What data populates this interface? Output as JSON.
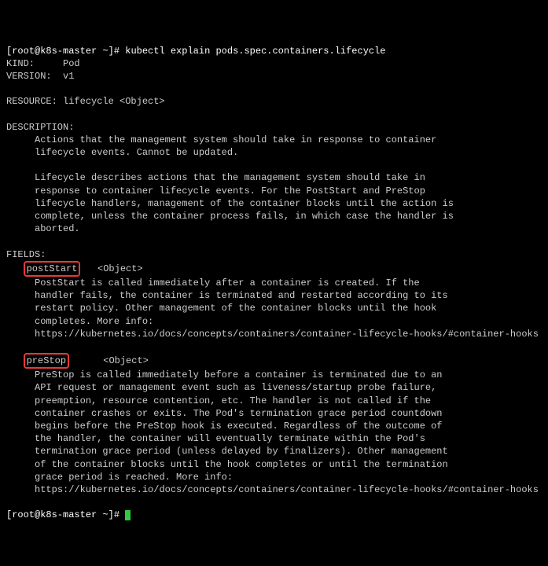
{
  "prompt1": {
    "open": "[",
    "userhost": "root@k8s-master",
    "sep": " ",
    "path": "~",
    "close": "]#",
    "command": " kubectl explain pods.spec.containers.lifecycle"
  },
  "kind_line": "KIND:     Pod",
  "version_line": "VERSION:  v1",
  "resource_line": "RESOURCE: lifecycle <Object>",
  "description_header": "DESCRIPTION:",
  "description_p1": "     Actions that the management system should take in response to container\n     lifecycle events. Cannot be updated.",
  "description_p2": "     Lifecycle describes actions that the management system should take in\n     response to container lifecycle events. For the PostStart and PreStop\n     lifecycle handlers, management of the container blocks until the action is\n     complete, unless the container process fails, in which case the handler is\n     aborted.",
  "fields_header": "FIELDS:",
  "postStart": {
    "name": "postStart",
    "type": "   <Object>",
    "desc": "     PostStart is called immediately after a container is created. If the\n     handler fails, the container is terminated and restarted according to its\n     restart policy. Other management of the container blocks until the hook\n     completes. More info:\n     https://kubernetes.io/docs/concepts/containers/container-lifecycle-hooks/#container-hooks"
  },
  "preStop": {
    "name": "preStop",
    "type": "      <Object>",
    "desc": "     PreStop is called immediately before a container is terminated due to an\n     API request or management event such as liveness/startup probe failure,\n     preemption, resource contention, etc. The handler is not called if the\n     container crashes or exits. The Pod's termination grace period countdown\n     begins before the PreStop hook is executed. Regardless of the outcome of\n     the handler, the container will eventually terminate within the Pod's\n     termination grace period (unless delayed by finalizers). Other management\n     of the container blocks until the hook completes or until the termination\n     grace period is reached. More info:\n     https://kubernetes.io/docs/concepts/containers/container-lifecycle-hooks/#container-hooks"
  },
  "prompt2": {
    "open": "[",
    "userhost": "root@k8s-master",
    "sep": " ",
    "path": "~",
    "close": "]#",
    "command": " "
  }
}
